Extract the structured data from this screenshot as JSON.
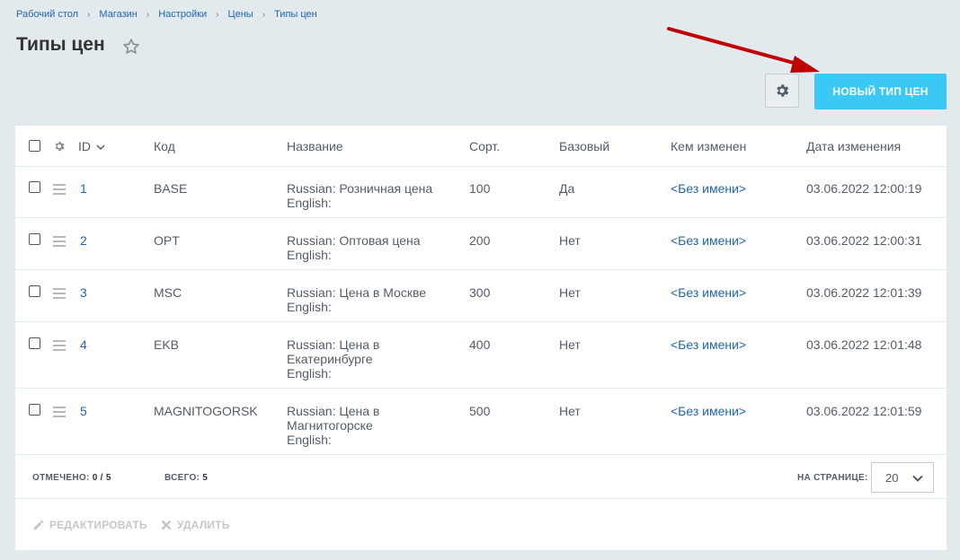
{
  "breadcrumb": [
    "Рабочий стол",
    "Магазин",
    "Настройки",
    "Цены",
    "Типы цен"
  ],
  "page": {
    "title": "Типы цен"
  },
  "toolbar": {
    "new_label": "НОВЫЙ ТИП ЦЕН"
  },
  "columns": {
    "id": "ID",
    "code": "Код",
    "name": "Название",
    "sort": "Сорт.",
    "base": "Базовый",
    "modified_by": "Кем изменен",
    "modified_date": "Дата изменения"
  },
  "rows": [
    {
      "id": "1",
      "code": "BASE",
      "name": [
        "Russian: Розничная цена",
        "English:"
      ],
      "sort": "100",
      "base": "Да",
      "modified_by": "<Без имени>",
      "modified_date": "03.06.2022 12:00:19"
    },
    {
      "id": "2",
      "code": "OPT",
      "name": [
        "Russian: Оптовая цена",
        "English:"
      ],
      "sort": "200",
      "base": "Нет",
      "modified_by": "<Без имени>",
      "modified_date": "03.06.2022 12:00:31"
    },
    {
      "id": "3",
      "code": "MSC",
      "name": [
        "Russian: Цена в Москве",
        "English:"
      ],
      "sort": "300",
      "base": "Нет",
      "modified_by": "<Без имени>",
      "modified_date": "03.06.2022 12:01:39"
    },
    {
      "id": "4",
      "code": "EKB",
      "name": [
        "Russian: Цена в",
        "Екатеринбурге",
        "English:"
      ],
      "sort": "400",
      "base": "Нет",
      "modified_by": "<Без имени>",
      "modified_date": "03.06.2022 12:01:48"
    },
    {
      "id": "5",
      "code": "MAGNITOGORSK",
      "name": [
        "Russian: Цена в",
        "Магнитогорске",
        "English:"
      ],
      "sort": "500",
      "base": "Нет",
      "modified_by": "<Без имени>",
      "modified_date": "03.06.2022 12:01:59"
    }
  ],
  "footer": {
    "selected_label": "ОТМЕЧЕНО:",
    "selected_value": "0 / 5",
    "total_label": "ВСЕГО:",
    "total_value": "5",
    "per_page_label": "НА СТРАНИЦЕ:",
    "per_page_value": "20"
  },
  "actions": {
    "edit_label": "РЕДАКТИРОВАТЬ",
    "delete_label": "УДАЛИТЬ"
  },
  "colors": {
    "accent": "#3bc8f5",
    "link": "#2067b0",
    "arrow": "#c00000"
  }
}
